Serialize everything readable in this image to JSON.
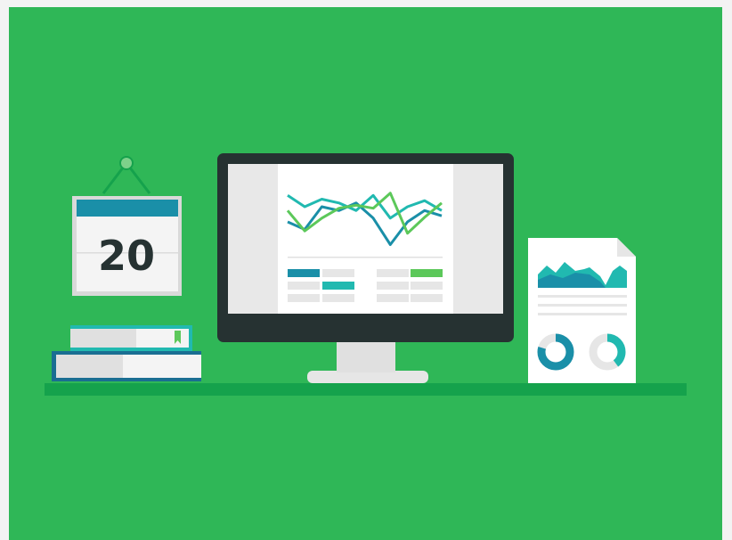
{
  "illustration": {
    "colors": {
      "background": "#2fb757",
      "desk": "#15a24c",
      "dark": "#263232",
      "light_gray": "#e6e6e6",
      "teal": "#1a8fa8",
      "cyan": "#21b9b0",
      "lime": "#5cc85a",
      "page_border": "#d9d9d9"
    },
    "calendar": {
      "day": "20",
      "icons": [
        "hook-icon"
      ]
    },
    "books": {
      "icons": [
        "bookmark-icon"
      ]
    },
    "monitor": {
      "chart_data": {
        "type": "line",
        "series": [
          {
            "color": "#1a8fa8",
            "values": [
              4,
              3,
              6,
              5.5,
              6.5,
              4.5,
              1,
              4,
              5.5,
              4.8
            ]
          },
          {
            "color": "#21b9b0",
            "values": [
              7.5,
              6,
              7,
              6.5,
              5.5,
              7.5,
              4.5,
              6,
              6.8,
              5.5
            ]
          },
          {
            "color": "#5cc85a",
            "values": [
              5.5,
              2.8,
              4.5,
              5.8,
              6.2,
              5.8,
              7.8,
              2.5,
              4.6,
              6.5
            ]
          }
        ]
      }
    },
    "report": {
      "icons": [
        "donut-chart-icon",
        "donut-chart-icon"
      ]
    }
  }
}
